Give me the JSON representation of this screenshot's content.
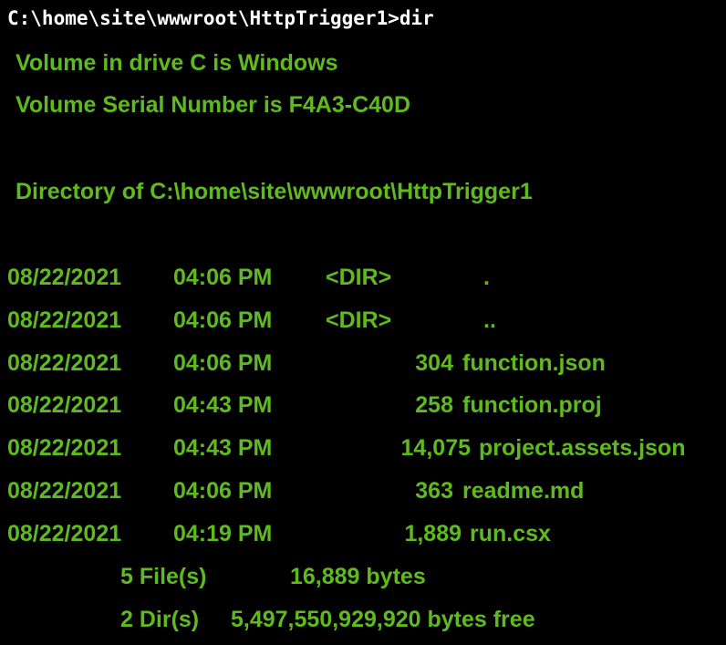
{
  "terminal": {
    "prompt_command": "C:\\home\\site\\wwwroot\\HttpTrigger1>dir",
    "volume_line": "Volume in drive C is Windows",
    "serial_line": "Volume Serial Number is F4A3-C40D",
    "directory_line": "Directory of C:\\home\\site\\wwwroot\\HttpTrigger1",
    "entries": [
      {
        "date": "08/22/2021",
        "time": "04:06 PM",
        "dir": "<DIR>",
        "size": "",
        "name": "."
      },
      {
        "date": "08/22/2021",
        "time": "04:06 PM",
        "dir": "<DIR>",
        "size": "",
        "name": ".."
      },
      {
        "date": "08/22/2021",
        "time": "04:06 PM",
        "dir": "",
        "size": "304",
        "name": "function.json"
      },
      {
        "date": "08/22/2021",
        "time": "04:43 PM",
        "dir": "",
        "size": "258",
        "name": "function.proj"
      },
      {
        "date": "08/22/2021",
        "time": "04:43 PM",
        "dir": "",
        "size": "14,075",
        "name": "project.assets.json"
      },
      {
        "date": "08/22/2021",
        "time": "04:06 PM",
        "dir": "",
        "size": "363",
        "name": "readme.md"
      },
      {
        "date": "08/22/2021",
        "time": "04:19 PM",
        "dir": "",
        "size": "1,889",
        "name": "run.csx"
      }
    ],
    "files_summary": {
      "count": "5 File(s)",
      "bytes": "16,889 bytes"
    },
    "dirs_summary": {
      "count": "2 Dir(s)",
      "bytes": "5,497,550,929,920 bytes free"
    },
    "colors": {
      "background": "#000000",
      "prompt_text": "#ffffff",
      "output_text": "#5fba1f"
    }
  }
}
